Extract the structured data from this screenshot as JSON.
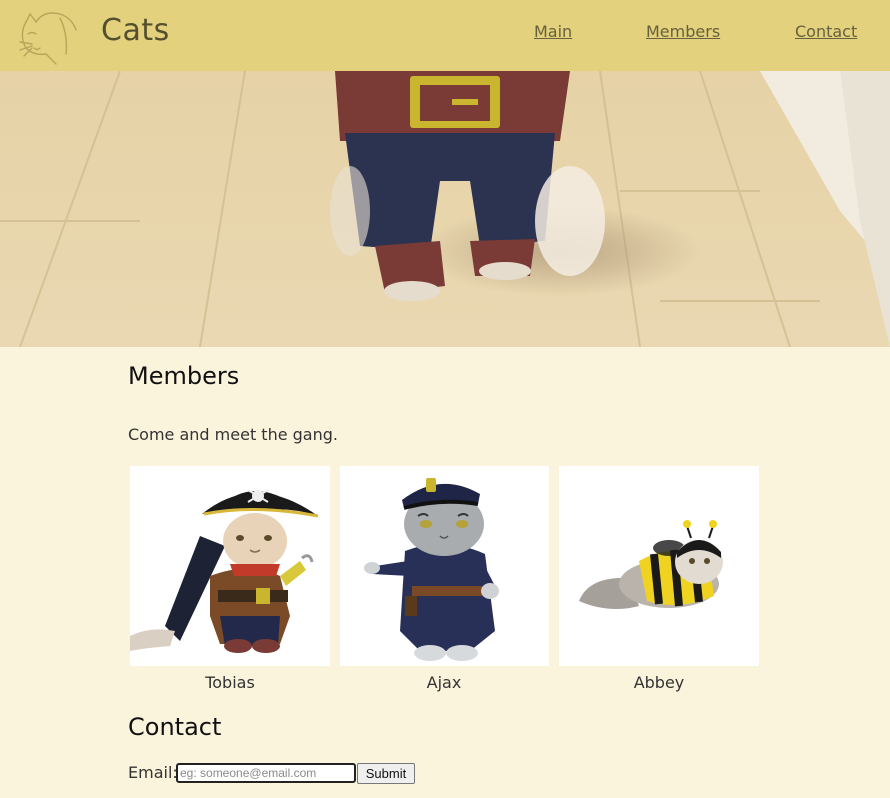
{
  "header": {
    "logo_icon": "cat-line-icon",
    "title": "Cats",
    "nav": [
      {
        "label": "Main"
      },
      {
        "label": "Members"
      },
      {
        "label": "Contact"
      }
    ]
  },
  "members": {
    "title": "Members",
    "intro": "Come and meet the gang.",
    "cats": [
      {
        "name": "Tobias",
        "costume": "pirate"
      },
      {
        "name": "Ajax",
        "costume": "police"
      },
      {
        "name": "Abbey",
        "costume": "bee"
      }
    ]
  },
  "contact": {
    "title": "Contact",
    "email_label": "Email:",
    "email_placeholder": "eg: someone@email.com",
    "email_value": "",
    "submit_label": "Submit"
  },
  "colors": {
    "header_bg": "#e3d17e",
    "page_bg": "#fbf4dc"
  }
}
